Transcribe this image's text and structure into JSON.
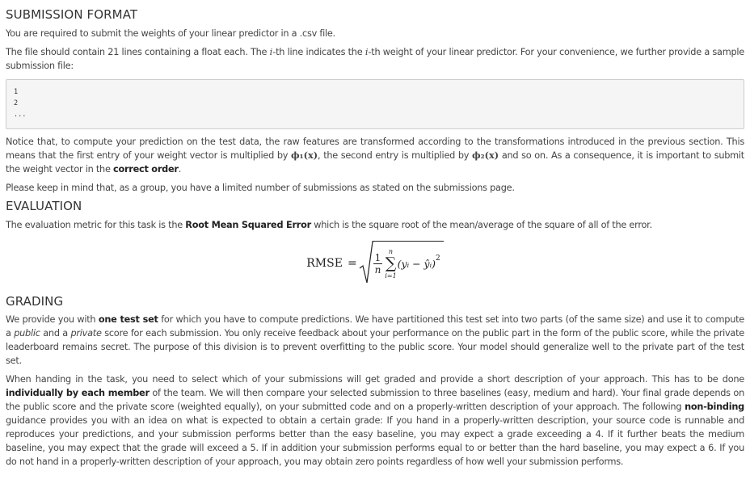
{
  "submission": {
    "heading": "SUBMISSION FORMAT",
    "p1": "You are required to submit the weights of your linear predictor in a .csv file.",
    "p2a": "The file should contain 21 lines containing a float each. The ",
    "i1": "i",
    "p2b": "-th line indicates the ",
    "i2": "i",
    "p2c": "-th weight of your linear predictor. For your convenience, we further provide a sample submission file:",
    "code_lines": [
      "1",
      "2",
      "..."
    ],
    "p3a": "Notice that, to compute your prediction on the test data, the raw features are transformed according to the transformations introduced in the previous section. This means that the first entry of your weight vector is multiplied by ",
    "phi1": "ϕ₁(x)",
    "p3b": ", the second entry is multiplied by ",
    "phi2": "ϕ₂(x)",
    "p3c": " and so on. As a consequence, it is important to submit the weight vector in the ",
    "p3bold": "correct order",
    "p3d": ".",
    "p4": "Please keep in mind that, as a group, you have a limited number of submissions as stated on the submissions page."
  },
  "evaluation": {
    "heading": "EVALUATION",
    "p1a": "The evaluation metric for this task is the ",
    "p1bold": "Root Mean Squared Error",
    "p1b": " which is the square root of the mean/average of the square of all of the error.",
    "formula": {
      "lhs": "RMSE",
      "eq": "=",
      "num": "1",
      "den": "n",
      "sum_top": "n",
      "sum_bottom": "i=1",
      "body": "(yᵢ − ŷᵢ)",
      "exp": "2"
    }
  },
  "grading": {
    "heading": "GRADING",
    "p1a": "We provide you with ",
    "p1bold": "one test set",
    "p1b": " for which you have to compute predictions. We have partitioned this test set into two parts (of the same size) and use it to compute a ",
    "p1i1": "public",
    "p1c": " and a ",
    "p1i2": "private",
    "p1d": " score for each submission. You only receive feedback about your performance on the public part in the form of the public score, while the private leaderboard remains secret. The purpose of this division is to prevent overfitting to the public score. Your model should generalize well to the private part of the test set.",
    "p2a": "When handing in the task, you need to select which of your submissions will get graded and provide a short description of your approach. This has to be done ",
    "p2bold1": "individually by each member",
    "p2b": " of the team. We will then compare your selected submission to three baselines (easy, medium and hard). Your final grade depends on the public score and the private score (weighted equally), on your submitted code and on a properly-written description of your approach. The following ",
    "p2bold2": "non-binding",
    "p2c": " guidance provides you with an idea on what is expected to obtain a certain grade: If you hand in a properly-written description, your source code is runnable and reproduces your predictions, and your submission performs better than the easy baseline, you may expect a grade exceeding a 4. If it further beats the medium baseline, you may expect that the grade will exceed a 5. If in addition your submission performs equal to or better than the hard baseline, you may expect a 6. If you do not hand in a properly-written description of your approach, you may obtain zero points regardless of how well your submission performs."
  }
}
